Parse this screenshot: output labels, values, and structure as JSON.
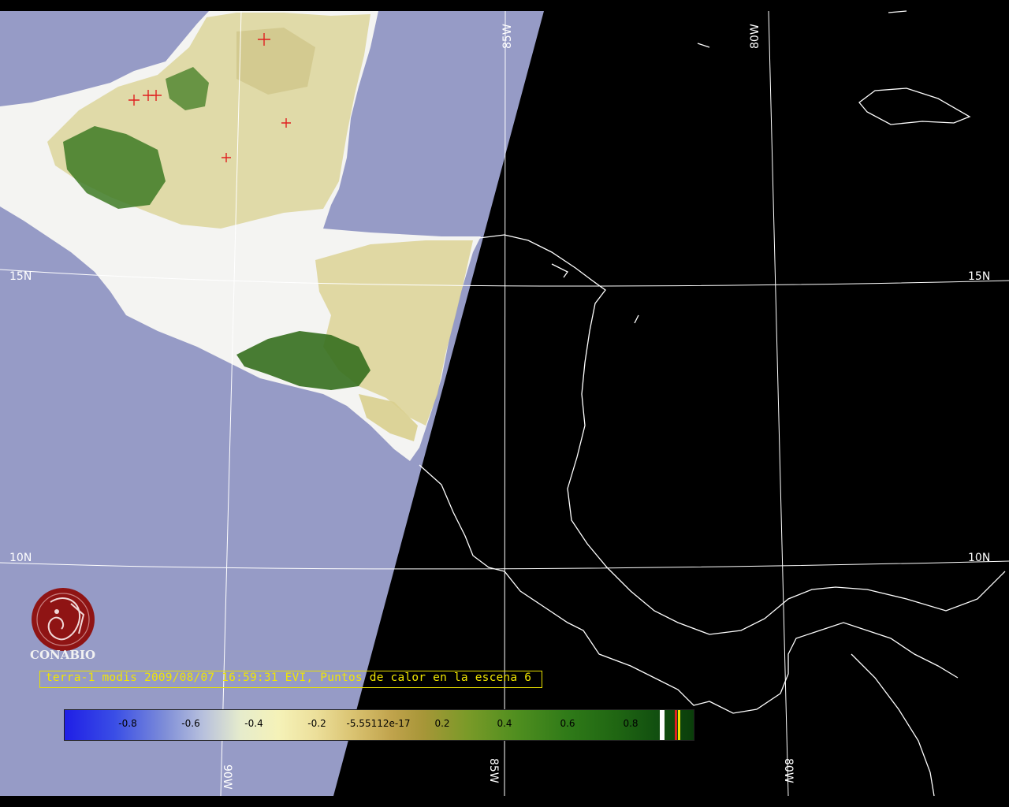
{
  "map": {
    "grid_labels": {
      "lat_15_left": "15N",
      "lat_15_right": "15N",
      "lat_10_left": "10N",
      "lat_10_right": "10N",
      "lon_85_top": "85W",
      "lon_80_top": "80W",
      "lon_90_bottom": "90W",
      "lon_85_bottom": "85W",
      "lon_80_bottom": "80W"
    },
    "colors": {
      "ocean_swath": "#969bc6",
      "no_data": "#000000",
      "land_cloud": "#ffffff",
      "vegetation_low": "#e8dfa0",
      "vegetation_high": "#2f6e1c",
      "coastline": "#ffffff",
      "grid": "#ffffff",
      "hotspot": "#e02020"
    },
    "hotspot_count_shown": 6
  },
  "caption": {
    "text": "terra-1 modis 2009/08/07 16:59:31 EVI, Puntos de calor en la escena 6"
  },
  "logo": {
    "name": "CONABIO",
    "icon": "conabio-macaw-logo"
  },
  "colorbar": {
    "ticks": [
      "-0.8",
      "-0.6",
      "-0.4",
      "-0.2",
      "-5.55112e-17",
      "0.2",
      "0.4",
      "0.6",
      "0.8"
    ],
    "gradient_colors": [
      "#1f1fe6",
      "#b7c0dd",
      "#f5f2b8",
      "#c0a34c",
      "#4f8e1f",
      "#0a3e0a"
    ],
    "end_swatches": [
      "#ffffff",
      "#e02020",
      "#f0e000"
    ]
  }
}
